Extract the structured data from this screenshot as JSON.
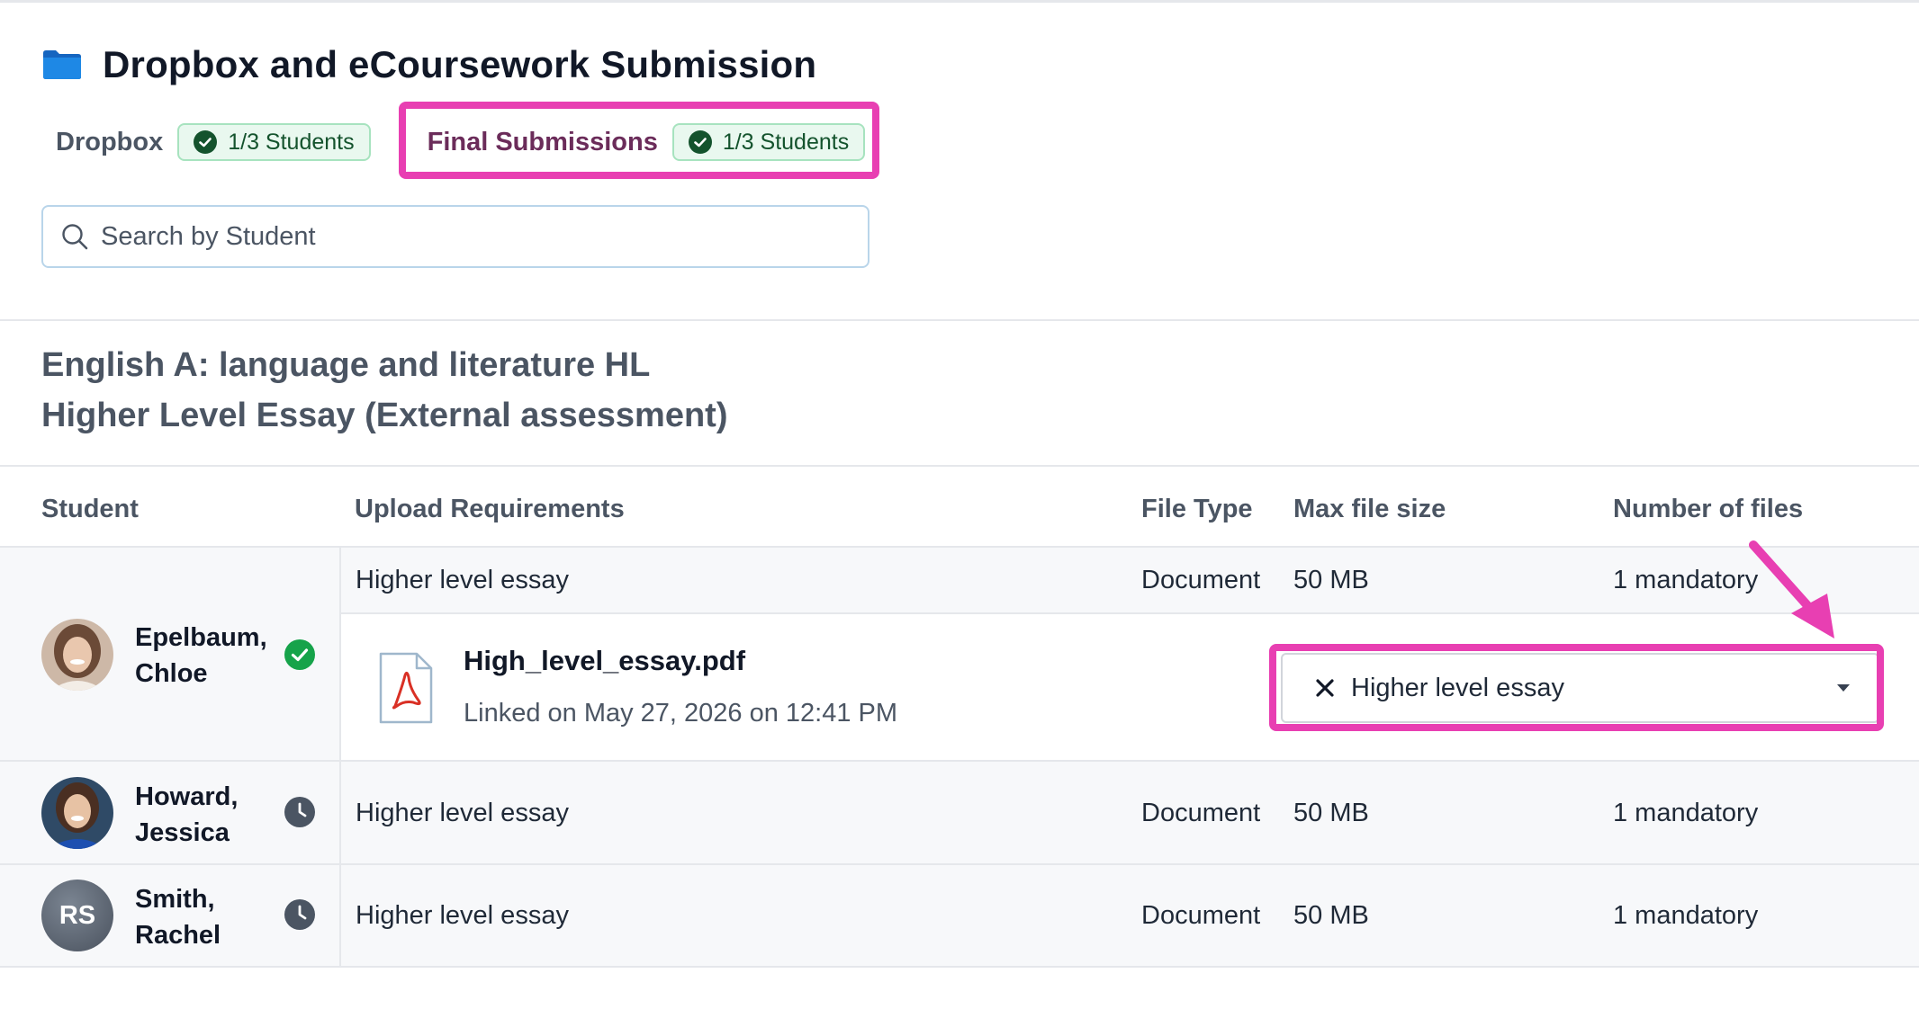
{
  "header": {
    "title": "Dropbox and eCoursework Submission",
    "folder_icon": "folder-icon"
  },
  "tabs": [
    {
      "label": "Dropbox",
      "badge": "1/3 Students",
      "active": false
    },
    {
      "label": "Final Submissions",
      "badge": "1/3 Students",
      "active": true
    }
  ],
  "search": {
    "placeholder": "Search by Student",
    "value": ""
  },
  "section": {
    "course": "English A: language and literature HL",
    "assessment": "Higher Level Essay (External assessment)"
  },
  "table": {
    "columns": [
      "Student",
      "Upload Requirements",
      "File Type",
      "Max file size",
      "Number of files"
    ],
    "rows": [
      {
        "student_last": "Epelbaum,",
        "student_first": "Chloe",
        "status": "submitted",
        "requirement": "Higher level essay",
        "file_type": "Document",
        "max_size": "50 MB",
        "files": "1 mandatory",
        "attachment": {
          "file_name": "High_level_essay.pdf",
          "linked": "Linked on May 27, 2026 on 12:41 PM",
          "requirement_select": "Higher level essay"
        }
      },
      {
        "student_last": "Howard,",
        "student_first": "Jessica",
        "status": "pending",
        "requirement": "Higher level essay",
        "file_type": "Document",
        "max_size": "50 MB",
        "files": "1 mandatory"
      },
      {
        "student_last": "Smith,",
        "student_first": "Rachel",
        "initials": "RS",
        "status": "pending",
        "requirement": "Higher level essay",
        "file_type": "Document",
        "max_size": "50 MB",
        "files": "1 mandatory"
      }
    ]
  },
  "colors": {
    "highlight": "#e83fb2",
    "success": "#16a34a",
    "pending": "#4b5563",
    "active_tab": "#6b2c5a"
  }
}
